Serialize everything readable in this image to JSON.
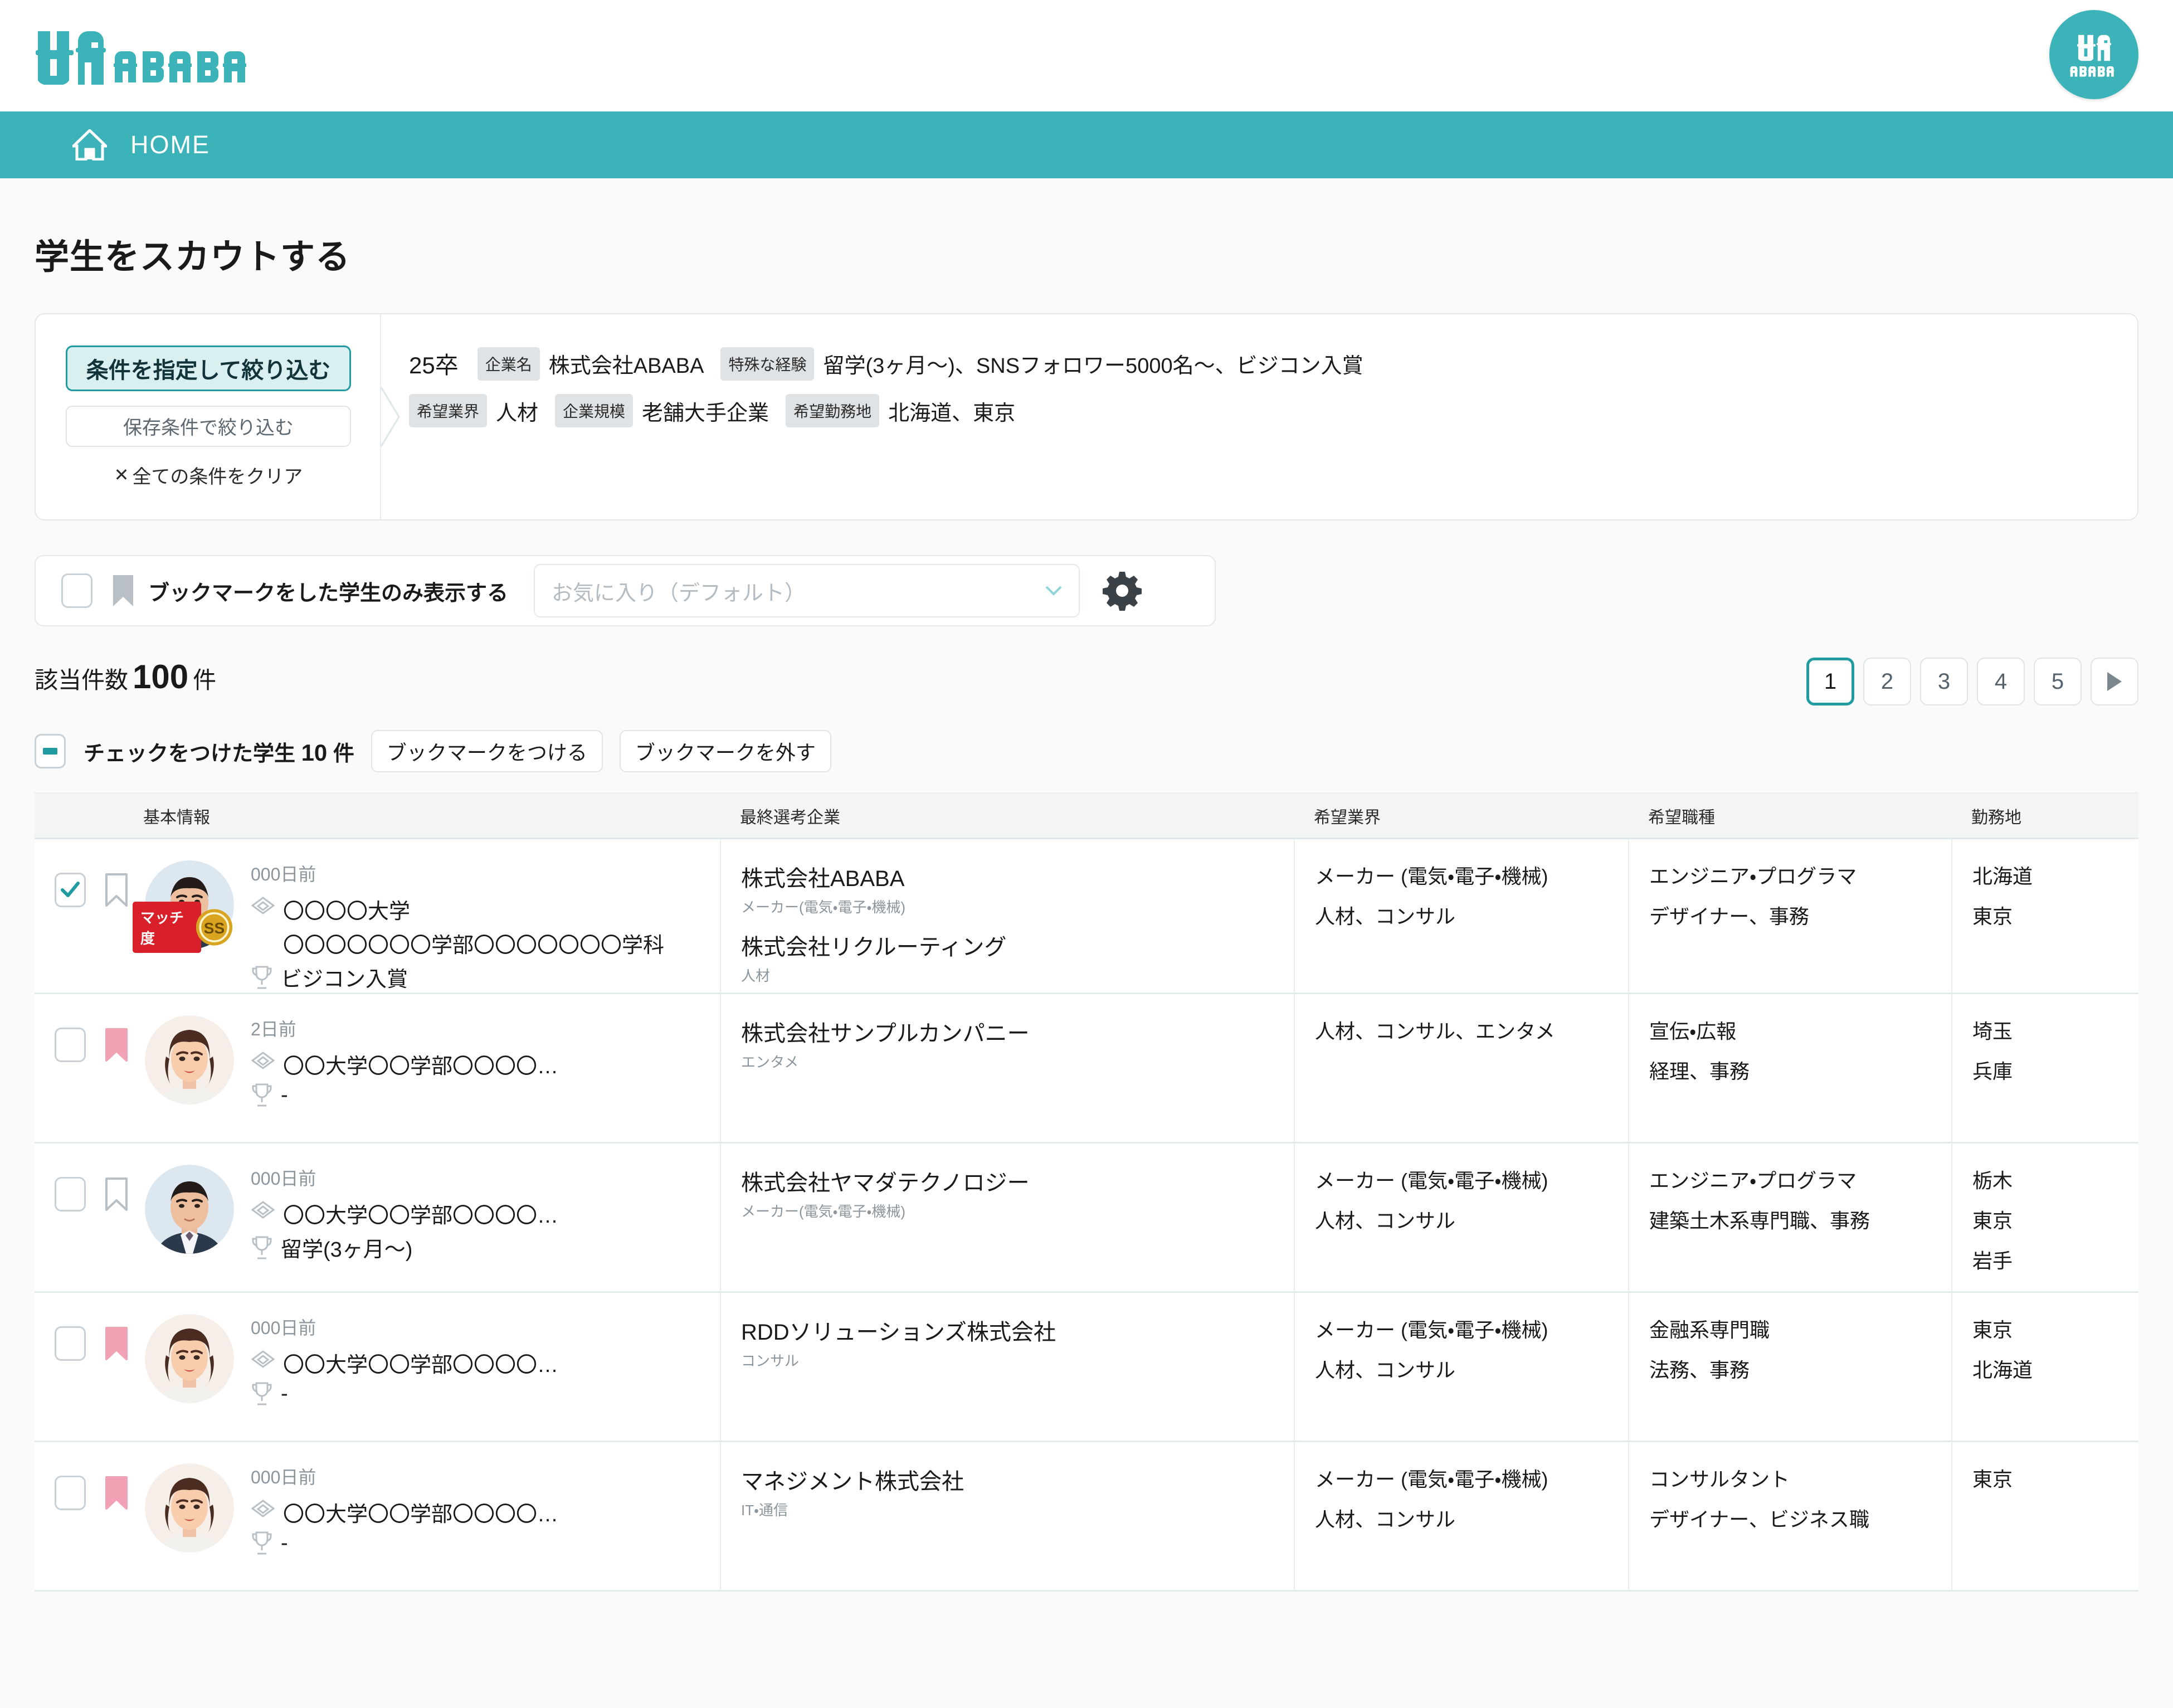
{
  "brand": {
    "logo_text": "ABABA",
    "avatar_text": "ABABA"
  },
  "nav": {
    "home_label": "HOME"
  },
  "page": {
    "title": "学生をスカウトする"
  },
  "filter": {
    "specify_button": "条件を指定して絞り込む",
    "saved_button": "保存条件で絞り込む",
    "clear_x": "✕",
    "clear_label": "全ての条件をクリア",
    "grad_year": "25卒",
    "chips": [
      {
        "key": "企業名",
        "value": "株式会社ABABA"
      },
      {
        "key": "特殊な経験",
        "value": "留学(3ヶ月〜)、SNSフォロワー5000名〜、ビジコン入賞"
      },
      {
        "key": "希望業界",
        "value": "人材"
      },
      {
        "key": "企業規模",
        "value": "老舗大手企業"
      },
      {
        "key": "希望勤務地",
        "value": "北海道、東京"
      }
    ]
  },
  "bookmark_bar": {
    "label": "ブックマークをした学生のみ表示する",
    "checked": false,
    "select_placeholder": "お気に入り（デフォルト）"
  },
  "results": {
    "count_prefix": "該当件数",
    "count": "100",
    "count_suffix": "件",
    "pagination": {
      "pages": [
        "1",
        "2",
        "3",
        "4",
        "5"
      ],
      "active": "1",
      "next_label": "▶"
    }
  },
  "bulk": {
    "label_prefix": "チェックをつけた学生",
    "checked_count": "10",
    "label_suffix": "件",
    "add_bookmark": "ブックマークをつける",
    "remove_bookmark": "ブックマークを外す"
  },
  "table": {
    "headers": {
      "basic": "基本情報",
      "final": "最終選考企業",
      "industry": "希望業界",
      "job": "希望職種",
      "location": "勤務地"
    },
    "rows": [
      {
        "checked": true,
        "bookmarked": false,
        "photo": "male",
        "match_label": "マッチ度",
        "match_rank": "SS",
        "days": "000日前",
        "university": "〇〇〇〇大学",
        "department": "〇〇〇〇〇〇〇学部〇〇〇〇〇〇〇学科",
        "award": "ビジコン入賞",
        "companies": [
          {
            "name": "株式会社ABABA",
            "industry": "メーカー(電気・電子・機械)"
          },
          {
            "name": "株式会社リクルーティング",
            "industry": "人材"
          }
        ],
        "industries": [
          "メーカー (電気・電子・機械)",
          "人材、コンサル"
        ],
        "jobs": [
          "エンジニア・プログラマ",
          "デザイナー、事務"
        ],
        "locations": [
          "北海道",
          "東京"
        ]
      },
      {
        "checked": false,
        "bookmarked": true,
        "photo": "female",
        "match_label": "",
        "match_rank": "",
        "days": "2日前",
        "university": "〇〇大学〇〇学部〇〇〇〇…",
        "department": "",
        "award": "-",
        "companies": [
          {
            "name": "株式会社サンプルカンパニー",
            "industry": "エンタメ"
          }
        ],
        "industries": [
          "人材、コンサル、エンタメ"
        ],
        "jobs": [
          "宣伝・広報",
          "経理、事務"
        ],
        "locations": [
          "埼玉",
          "兵庫"
        ]
      },
      {
        "checked": false,
        "bookmarked": false,
        "photo": "male",
        "match_label": "",
        "match_rank": "",
        "days": "000日前",
        "university": "〇〇大学〇〇学部〇〇〇〇…",
        "department": "",
        "award": "留学(3ヶ月〜)",
        "companies": [
          {
            "name": "株式会社ヤマダテクノロジー",
            "industry": "メーカー(電気・電子・機械)"
          }
        ],
        "industries": [
          "メーカー (電気・電子・機械)",
          "人材、コンサル"
        ],
        "jobs": [
          "エンジニア・プログラマ",
          "建築土木系専門職、事務"
        ],
        "locations": [
          "栃木",
          "東京",
          "岩手"
        ]
      },
      {
        "checked": false,
        "bookmarked": true,
        "photo": "female",
        "match_label": "",
        "match_rank": "",
        "days": "000日前",
        "university": "〇〇大学〇〇学部〇〇〇〇…",
        "department": "",
        "award": "-",
        "companies": [
          {
            "name": "RDDソリューションズ株式会社",
            "industry": "コンサル"
          }
        ],
        "industries": [
          "メーカー (電気・電子・機械)",
          "人材、コンサル"
        ],
        "jobs": [
          "金融系専門職",
          "法務、事務"
        ],
        "locations": [
          "東京",
          "北海道"
        ]
      },
      {
        "checked": false,
        "bookmarked": true,
        "photo": "female",
        "match_label": "",
        "match_rank": "",
        "days": "000日前",
        "university": "〇〇大学〇〇学部〇〇〇〇…",
        "department": "",
        "award": "-",
        "companies": [
          {
            "name": "マネジメント株式会社",
            "industry": "IT・通信"
          }
        ],
        "industries": [
          "メーカー (電気・電子・機械)",
          "人材、コンサル"
        ],
        "jobs": [
          "コンサルタント",
          "デザイナー、ビジネス職"
        ],
        "locations": [
          "東京"
        ]
      }
    ]
  },
  "colors": {
    "brand_teal": "#3bb3b8",
    "accent_teal": "#1f9ba1",
    "bookmark_pink": "#f2a0b4",
    "bookmark_gray": "#b8c0c5",
    "match_red": "#d81f2a",
    "match_gold": "#d9a520"
  }
}
